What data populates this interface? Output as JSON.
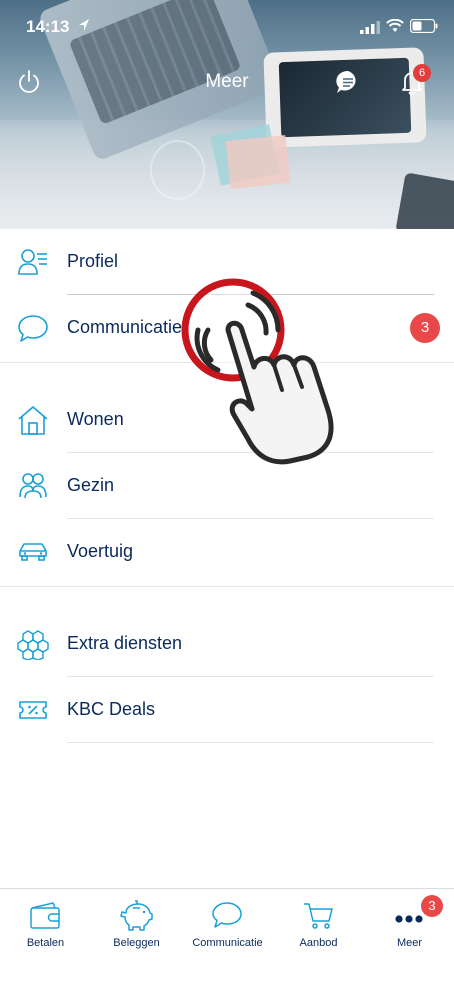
{
  "status_bar": {
    "time": "14:13"
  },
  "nav": {
    "title": "Meer",
    "notifications_badge": "6"
  },
  "menu": {
    "items": [
      {
        "label": "Profiel",
        "icon": "profile-icon"
      },
      {
        "label": "Communicatie",
        "icon": "speech-bubble-icon",
        "badge": "3"
      },
      {
        "label": "Wonen",
        "icon": "house-icon"
      },
      {
        "label": "Gezin",
        "icon": "family-icon"
      },
      {
        "label": "Voertuig",
        "icon": "car-icon"
      },
      {
        "label": "Extra diensten",
        "icon": "hexagons-icon"
      },
      {
        "label": "KBC Deals",
        "icon": "ticket-icon"
      }
    ]
  },
  "tabs": [
    {
      "label": "Betalen",
      "icon": "wallet-icon"
    },
    {
      "label": "Beleggen",
      "icon": "piggy-bank-icon"
    },
    {
      "label": "Communicatie",
      "icon": "speech-bubble-icon"
    },
    {
      "label": "Aanbod",
      "icon": "cart-icon"
    },
    {
      "label": "Meer",
      "icon": "more-dots-icon",
      "badge": "3"
    }
  ],
  "colors": {
    "accent": "#1a9fd9",
    "text": "#0a2a5c",
    "badge": "#e94848",
    "tap_ring": "#c8161d"
  }
}
